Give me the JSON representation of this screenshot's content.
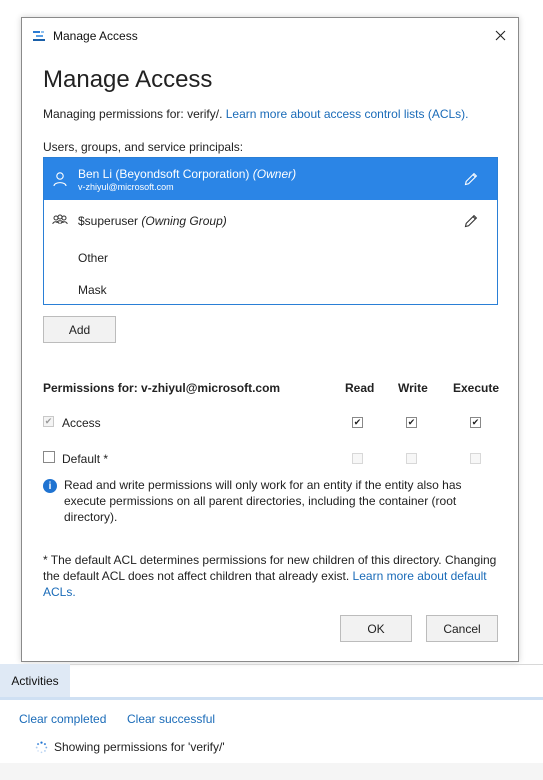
{
  "dialog": {
    "window_title": "Manage Access",
    "heading": "Manage Access",
    "managing_prefix": "Managing permissions for: verify/.",
    "learn_acl_link": "Learn more about access control lists (ACLs).",
    "principals_label": "Users, groups, and service principals:",
    "principals": [
      {
        "name": "Ben Li (Beyondsoft Corporation)",
        "role": "(Owner)",
        "email": "v-zhiyul@microsoft.com",
        "icon": "user-icon",
        "selected": true
      },
      {
        "name": "$superuser",
        "role": "(Owning Group)",
        "icon": "group-icon",
        "selected": false
      },
      {
        "name": "Other"
      },
      {
        "name": "Mask"
      }
    ],
    "add_label": "Add",
    "permissions": {
      "title": "Permissions for: v-zhiyul@microsoft.com",
      "columns": [
        "Read",
        "Write",
        "Execute"
      ],
      "rows": [
        {
          "label": "Access",
          "enabled": true,
          "read": true,
          "write": true,
          "execute": true
        },
        {
          "label": "Default *",
          "enabled": false,
          "read": false,
          "write": false,
          "execute": false
        }
      ]
    },
    "info_text": "Read and write permissions will only work for an entity if the entity also has execute permissions on all parent directories, including the container (root directory).",
    "footnote_text": "* The default ACL determines permissions for new children of this directory. Changing the default ACL does not affect children that already exist.",
    "footnote_link": "Learn more about default ACLs.",
    "ok_label": "OK",
    "cancel_label": "Cancel"
  },
  "activities": {
    "tab_label": "Activities",
    "clear_completed": "Clear completed",
    "clear_successful": "Clear successful",
    "items": [
      {
        "text": "Showing permissions for 'verify/'"
      }
    ]
  },
  "colors": {
    "accent": "#2b85e6",
    "link": "#1a6bb8",
    "info": "#1f73d1"
  }
}
